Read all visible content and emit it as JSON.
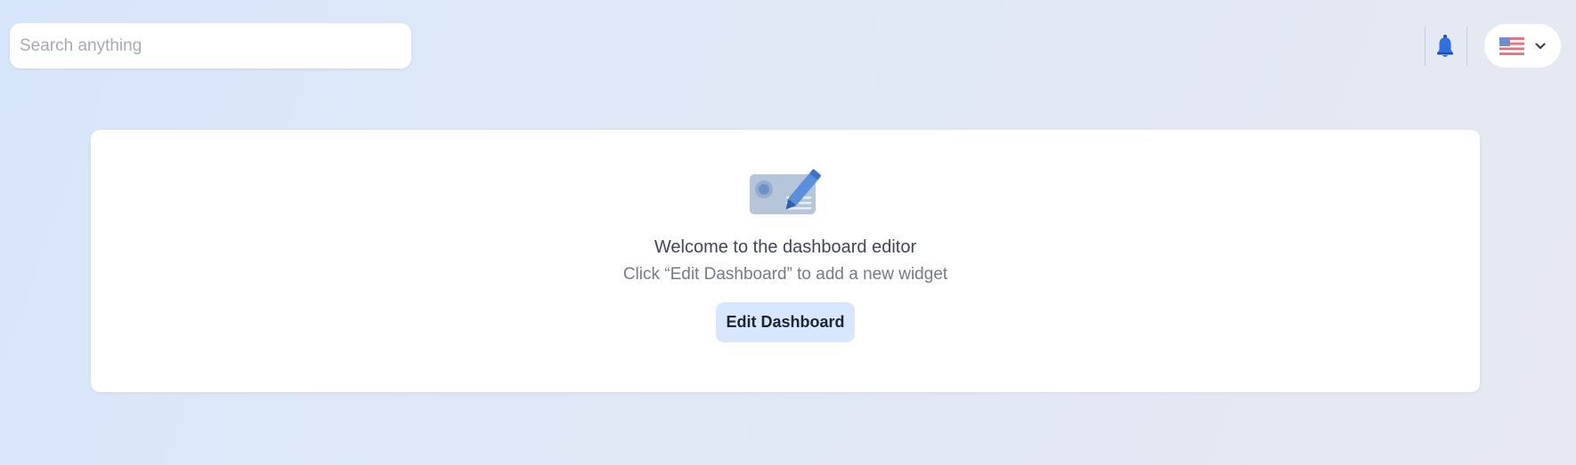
{
  "header": {
    "search": {
      "placeholder": "Search anything",
      "value": ""
    },
    "notifications": {
      "icon": "bell-icon",
      "color": "#2f6fdf"
    },
    "language": {
      "flag_icon": "us-flag-icon",
      "dropdown_icon": "chevron-down-icon"
    }
  },
  "empty_state": {
    "illustration_icon": "dashboard-edit-illustration",
    "title": "Welcome to the dashboard editor",
    "subtitle": "Click “Edit Dashboard” to add a new widget",
    "button_label": "Edit Dashboard",
    "button_color": "#d8e7fd"
  }
}
